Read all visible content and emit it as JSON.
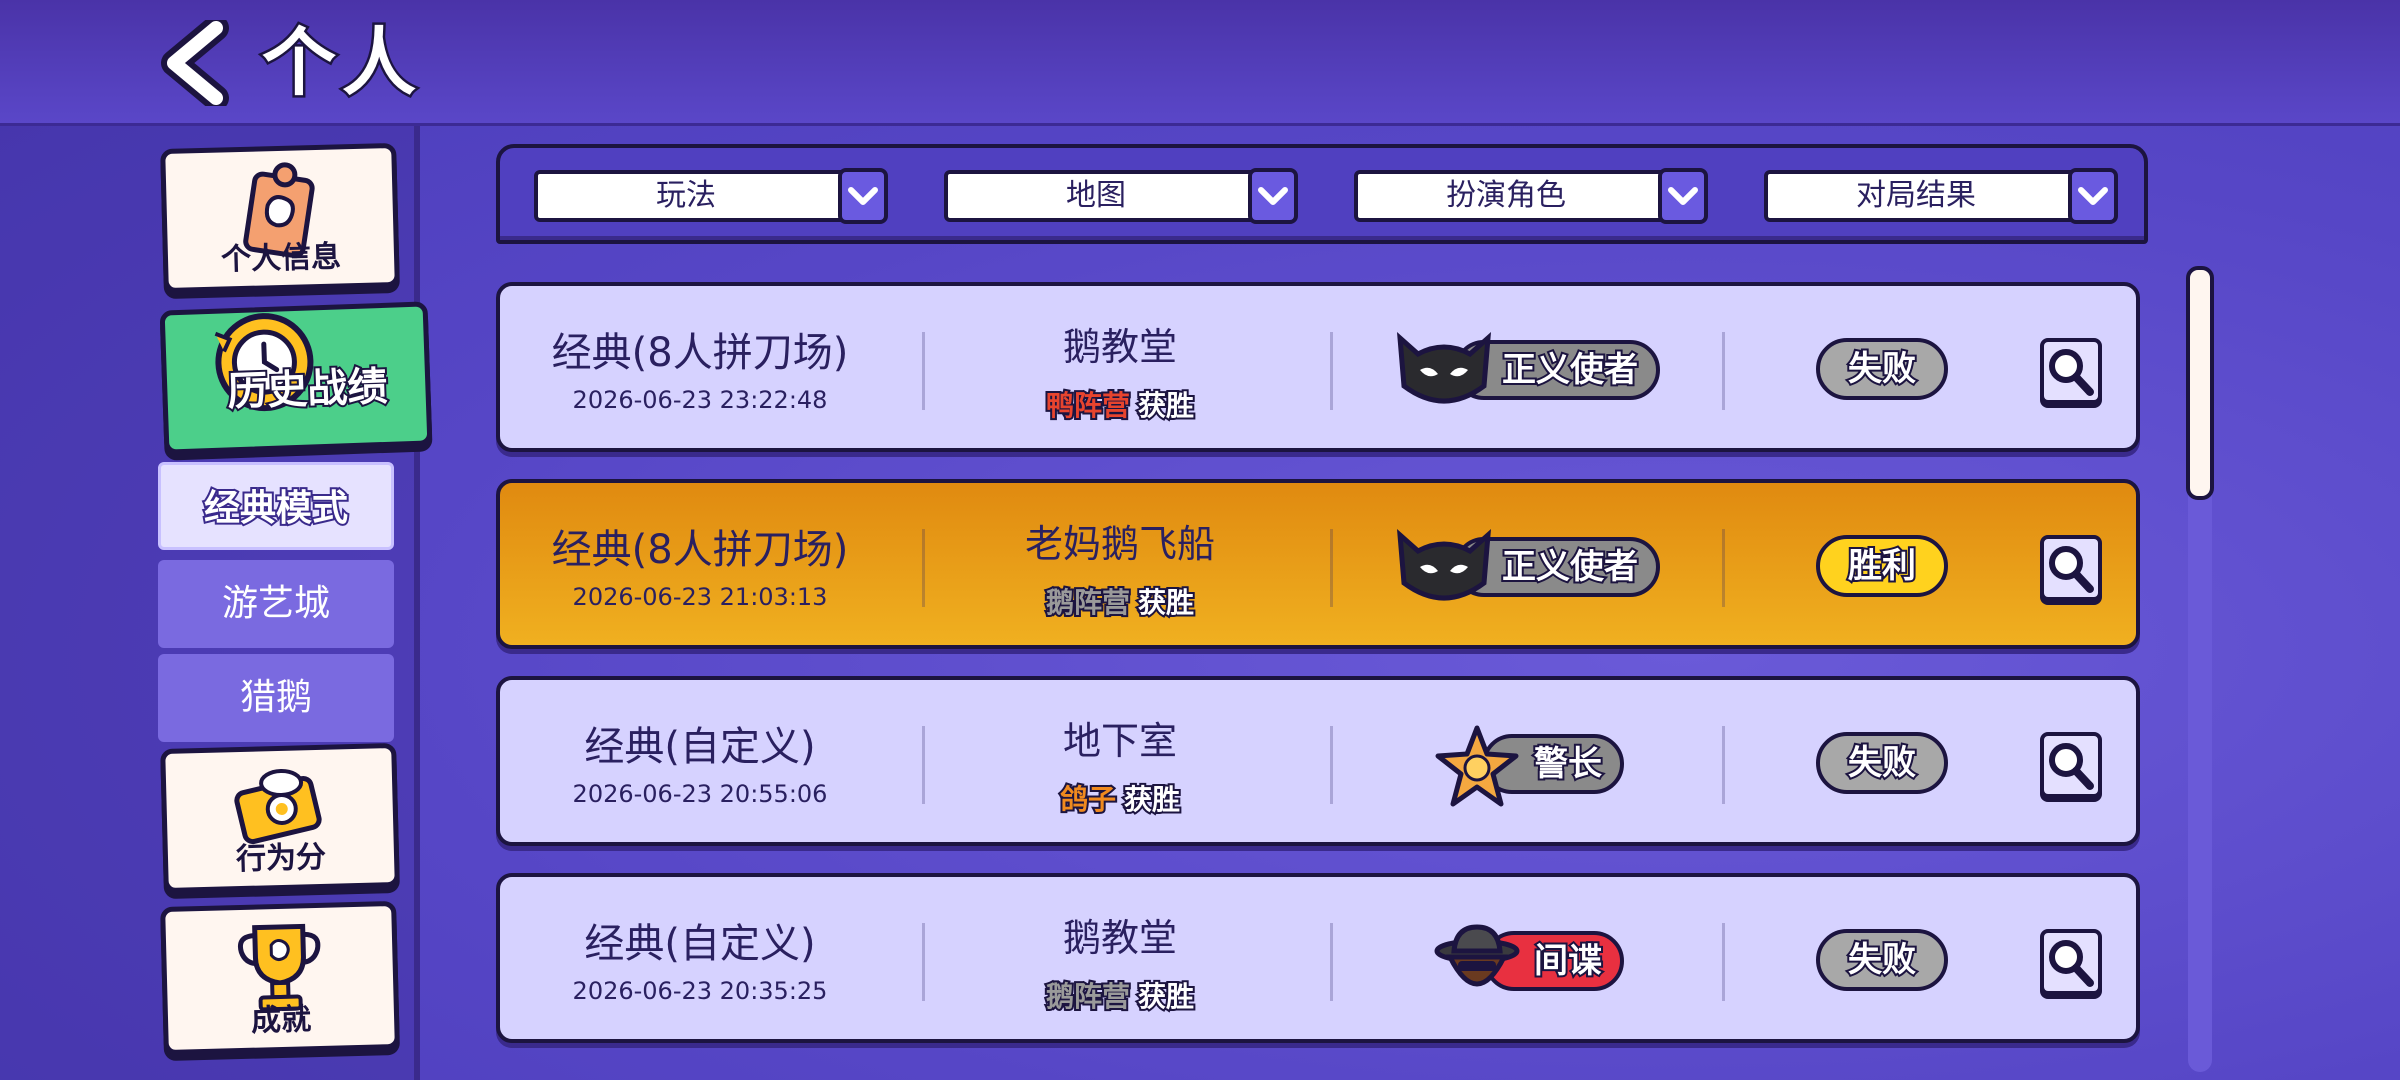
{
  "header": {
    "title": "个人"
  },
  "sidebar": {
    "cards": [
      {
        "label": "个人信息",
        "icon": "clipboard-icon"
      },
      {
        "label": "历史战绩",
        "icon": "clock-icon"
      },
      {
        "label": "行为分",
        "icon": "egg-note-icon"
      },
      {
        "label": "成就",
        "icon": "trophy-icon"
      }
    ],
    "sub_items": [
      "经典模式",
      "游艺城",
      "猎鹅"
    ]
  },
  "filters": [
    "玩法",
    "地图",
    "扮演角色",
    "对局结果"
  ],
  "matches": [
    {
      "mode": "经典(8人拼刀场)",
      "time": "2026-06-23 23:22:48",
      "map": "鹅教堂",
      "faction": "鸭阵营",
      "faction_color": "#e8442e",
      "faction_result": "获胜",
      "role": "正义使者",
      "role_icon": "bat-mask-icon",
      "result": "失败",
      "won": false
    },
    {
      "mode": "经典(8人拼刀场)",
      "time": "2026-06-23 21:03:13",
      "map": "老妈鹅飞船",
      "faction": "鹅阵营",
      "faction_color": "#9a9a9a",
      "faction_result": "获胜",
      "role": "正义使者",
      "role_icon": "bat-mask-icon",
      "result": "胜利",
      "won": true
    },
    {
      "mode": "经典(自定义)",
      "time": "2026-06-23 20:55:06",
      "map": "地下室",
      "faction": "鸽子",
      "faction_color": "#f08a1e",
      "faction_result": "获胜",
      "role": "警长",
      "role_icon": "sheriff-star-icon",
      "result": "失败",
      "won": false
    },
    {
      "mode": "经典(自定义)",
      "time": "2026-06-23 20:35:25",
      "map": "鹅教堂",
      "faction": "鹅阵营",
      "faction_color": "#9a9a9a",
      "faction_result": "获胜",
      "role": "间谍",
      "role_icon": "spy-hat-icon",
      "result": "失败",
      "won": false
    }
  ],
  "colors": {
    "accent": "#5a47c8",
    "win_row": "#f0b020",
    "active_card": "#4ccf8a",
    "spy_pill": "#e83040",
    "role_pill": "#8a8a8a"
  }
}
